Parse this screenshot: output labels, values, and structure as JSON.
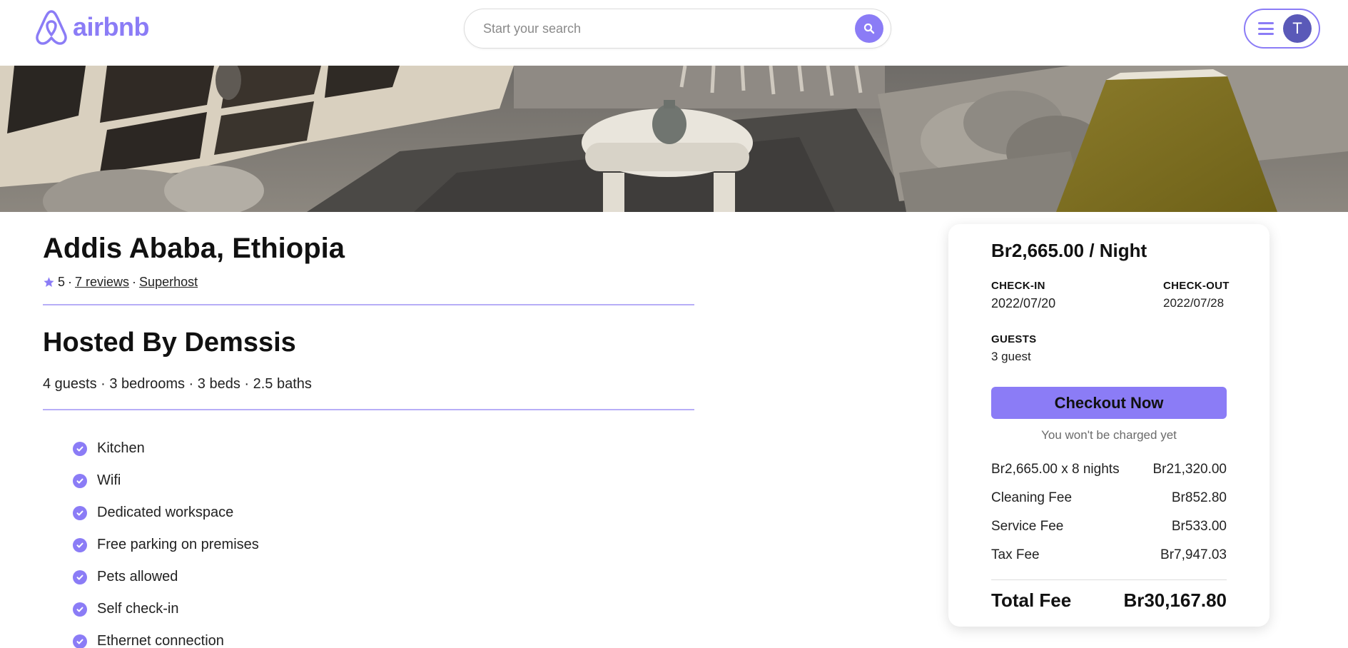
{
  "header": {
    "logo_text": "airbnb",
    "search_placeholder": "Start your search",
    "avatar_initial": "T"
  },
  "listing": {
    "title": "Addis Ababa, Ethiopia",
    "rating": "5",
    "reviews_link": "7 reviews",
    "superhost_link": "Superhost",
    "host_title": "Hosted By Demssis",
    "details": "4 guests · 3 bedrooms · 3 beds · 2.5 baths",
    "amenities": [
      "Kitchen",
      "Wifi",
      "Dedicated workspace",
      "Free parking on premises",
      "Pets allowed",
      "Self check-in",
      "Ethernet connection"
    ]
  },
  "booking": {
    "price": "Br2,665.00 / Night",
    "checkin_label": "CHECK-IN",
    "checkin_value": "2022/07/20",
    "checkout_label": "CHECK-OUT",
    "checkout_value": "2022/07/28",
    "guests_label": "GUESTS",
    "guests_value": "3 guest",
    "checkout_button": "Checkout Now",
    "charge_note": "You won't be charged yet",
    "fees": [
      {
        "label": "Br2,665.00 x 8 nights",
        "amount": "Br21,320.00"
      },
      {
        "label": "Cleaning Fee",
        "amount": "Br852.80"
      },
      {
        "label": "Service Fee",
        "amount": "Br533.00"
      },
      {
        "label": "Tax Fee",
        "amount": "Br7,947.03"
      }
    ],
    "total_label": "Total Fee",
    "total_amount": "Br30,167.80"
  },
  "colors": {
    "accent": "#8b7cf6",
    "avatar_bg": "#5a59b8",
    "divider": "#b7aef7"
  },
  "icons": {
    "logo": "airbnb-logo-icon",
    "search": "search-icon",
    "menu": "hamburger-menu-icon",
    "rating": "star-icon",
    "amenity": "check-circle-icon"
  }
}
